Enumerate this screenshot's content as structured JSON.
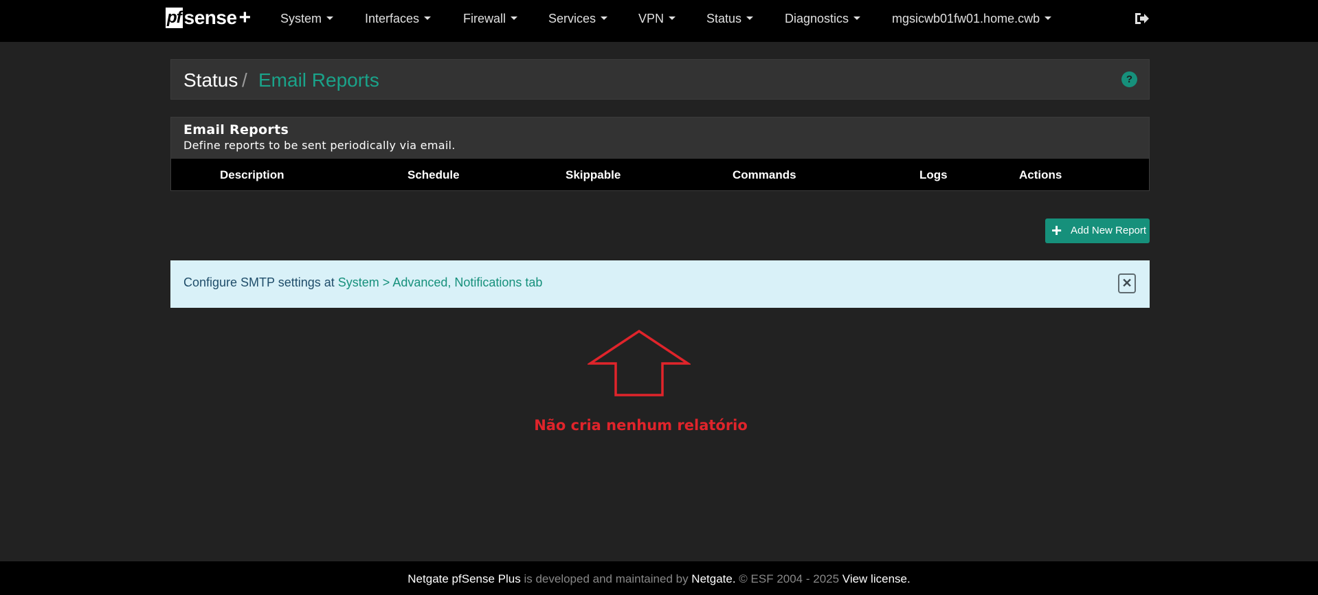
{
  "brand": {
    "pf": "pf",
    "sense": "sense",
    "plus": "+"
  },
  "nav": {
    "items": [
      {
        "label": "System"
      },
      {
        "label": "Interfaces"
      },
      {
        "label": "Firewall"
      },
      {
        "label": "Services"
      },
      {
        "label": "VPN"
      },
      {
        "label": "Status"
      },
      {
        "label": "Diagnostics"
      },
      {
        "label": "mgsicwb01fw01.home.cwb"
      }
    ],
    "logout_icon": "sign-out-icon"
  },
  "breadcrumb": {
    "section": "Status",
    "separator": "/",
    "current": "Email Reports",
    "help_glyph": "?"
  },
  "panel": {
    "title": "Email Reports",
    "subtitle": "Define reports to be sent periodically via email.",
    "columns": [
      "Description",
      "Schedule",
      "Skippable",
      "Commands",
      "Logs",
      "Actions"
    ]
  },
  "add_button": {
    "label": "Add New Report",
    "icon": "+"
  },
  "alert": {
    "text": "Configure SMTP settings at ",
    "link": "System > Advanced, Notifications tab",
    "close_glyph": "✕"
  },
  "annotation": {
    "text": "Não cria nenhum relatório",
    "color": "#e0242b"
  },
  "footer": {
    "product": "Netgate pfSense Plus",
    "middle": " is developed and maintained by ",
    "company": "Netgate.",
    "copyright": " © ESF 2004 - 2025 ",
    "license": "View license."
  },
  "colors": {
    "accent": "#16907b",
    "navbar": "#000000",
    "background": "#222222",
    "alert_bg": "#d9f1f8"
  }
}
